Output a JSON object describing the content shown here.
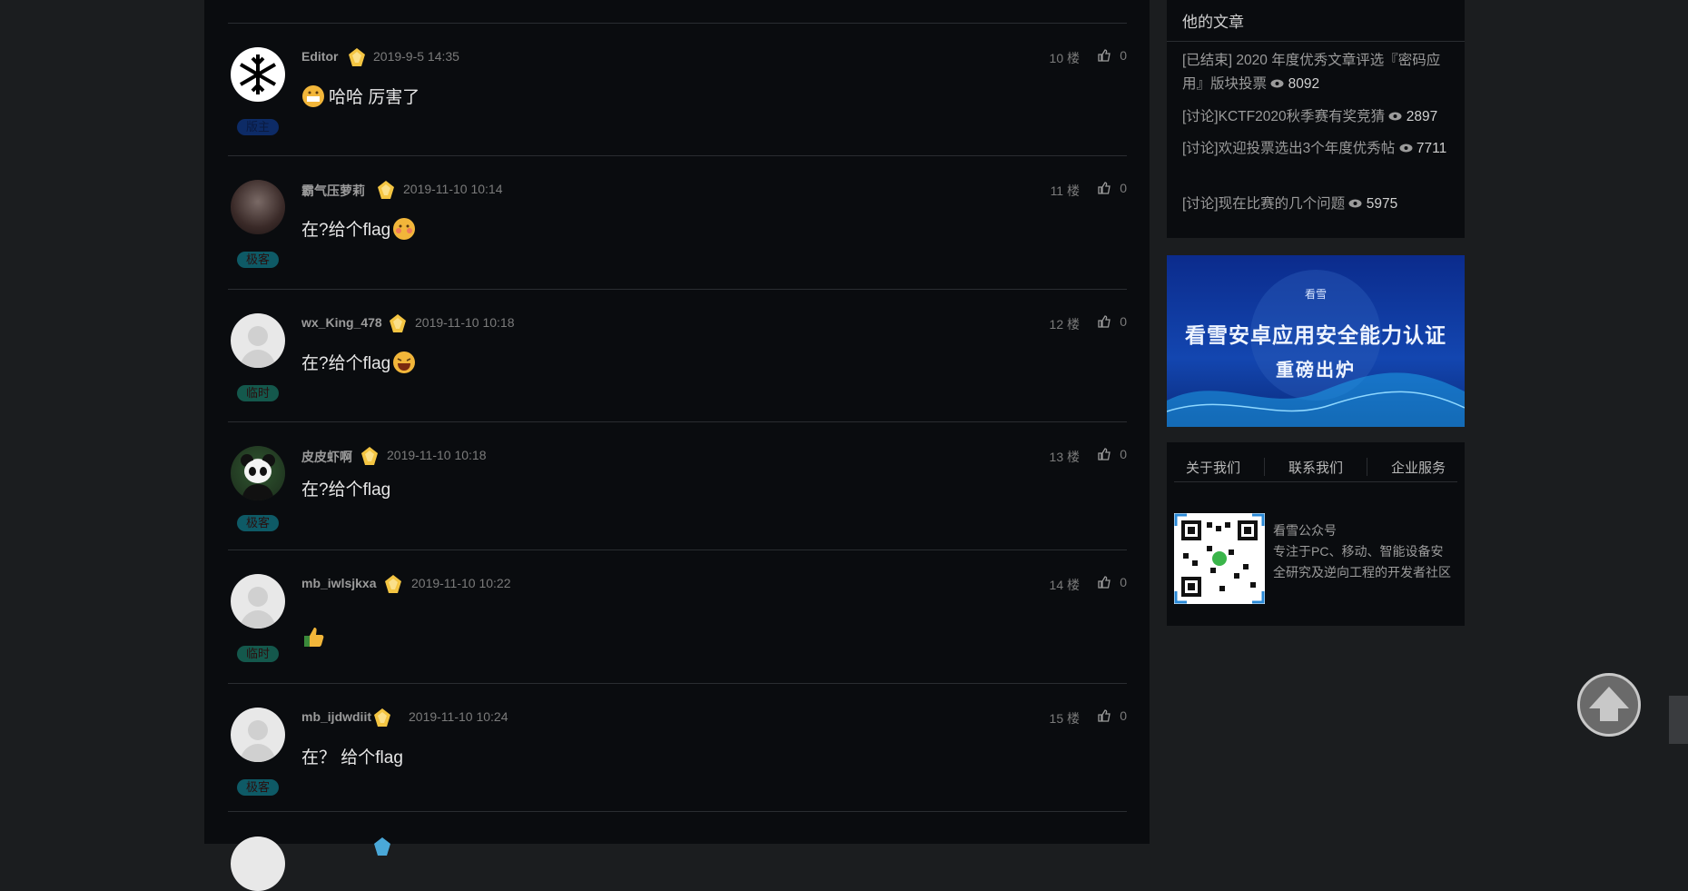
{
  "posts": [
    {
      "user": "Editor",
      "date": "2019-9-5 14:35",
      "floor": "10 楼",
      "likes": "0",
      "content": "哈哈 厉害了",
      "role": "版主",
      "emoji_pos": "before",
      "avatar": "snowflake-logo"
    },
    {
      "user": "霸气压萝莉",
      "date": "2019-11-10 10:14",
      "floor": "11 楼",
      "likes": "0",
      "content": "在?给个flag",
      "role": "极客",
      "emoji_pos": "after",
      "avatar": "photo-girl"
    },
    {
      "user": "wx_King_478",
      "date": "2019-11-10 10:18",
      "floor": "12 楼",
      "likes": "0",
      "content": "在?给个flag",
      "role": "临时",
      "emoji_pos": "after",
      "avatar": "default"
    },
    {
      "user": "皮皮虾啊",
      "date": "2019-11-10 10:18",
      "floor": "13 楼",
      "likes": "0",
      "content": "在?给个flag",
      "role": "极客",
      "emoji_pos": "none",
      "avatar": "panda"
    },
    {
      "user": "mb_iwlsjkxa",
      "date": "2019-11-10 10:22",
      "floor": "14 楼",
      "likes": "0",
      "content": "",
      "role": "临时",
      "emoji_pos": "thumb",
      "avatar": "default"
    },
    {
      "user": "mb_ijdwdiit",
      "date": "2019-11-10 10:24",
      "floor": "15 楼",
      "likes": "0",
      "content": "在？ 给个flag",
      "role": "极客",
      "emoji_pos": "none",
      "avatar": "default"
    }
  ],
  "sidebar": {
    "title": "他的文章",
    "articles": [
      {
        "text": "[已结束] 2020 年度优秀文章评选『密码应用』版块投票",
        "views": "8092"
      },
      {
        "text": "[讨论]KCTF2020秋季赛有奖竞猜",
        "views": "2897"
      },
      {
        "text": "[讨论]欢迎投票选出3个年度优秀帖",
        "views": "7711"
      },
      {
        "text": "[讨论]现在比赛的几个问题",
        "views": "5975"
      }
    ]
  },
  "banner": {
    "logo": "看雪",
    "line1": "看雪安卓应用安全能力认证",
    "line2": "重磅出炉"
  },
  "footer": {
    "links": [
      "关于我们",
      "联系我们",
      "企业服务"
    ],
    "qr_title": "看雪公众号",
    "qr_desc": "专注于PC、移动、智能设备安全研究及逆向工程的开发者社区"
  },
  "icons": {
    "like": "thumbs-up-icon",
    "eye": "eye-icon",
    "top": "back-to-top-icon"
  },
  "colors": {
    "bg": "#1b1d1f",
    "panel": "#0a0c0f",
    "medal": "#f4c542"
  }
}
